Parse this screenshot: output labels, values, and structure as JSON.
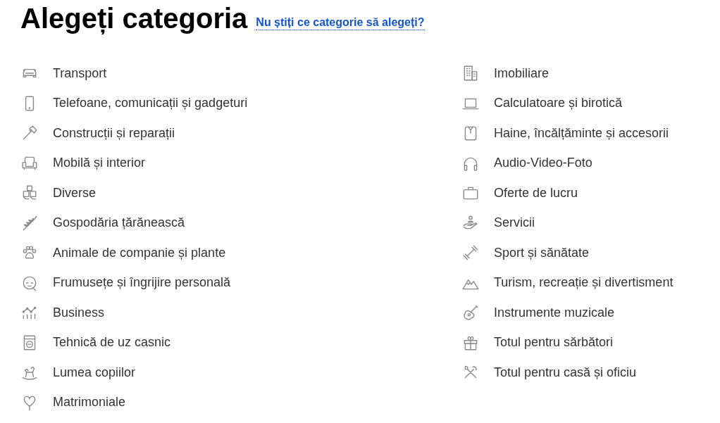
{
  "title": "Alegeți categoria",
  "help_link": "Nu știți ce categorie să alegeți?",
  "columns": [
    {
      "categories": [
        "Transport",
        "Telefoane, comunicații și gadgeturi",
        "Construcții și reparații",
        "Mobilă și interior",
        "Diverse",
        "Gospodăria țărănească",
        "Animale de companie și plante",
        "Frumusețe și îngrijire personală",
        "Business",
        "Tehnică de uz casnic",
        "Lumea copiilor",
        "Matrimoniale"
      ]
    },
    {
      "categories": [
        "Imobiliare",
        "Calculatoare și birotică",
        "Haine, încălțăminte și accesorii",
        "Audio-Video-Foto",
        "Oferte de lucru",
        "Servicii",
        "Sport și sănătate",
        "Turism, recreație și divertisment",
        "Instrumente muzicale",
        "Totul pentru sărbători",
        "Totul pentru casă și oficiu"
      ]
    }
  ]
}
